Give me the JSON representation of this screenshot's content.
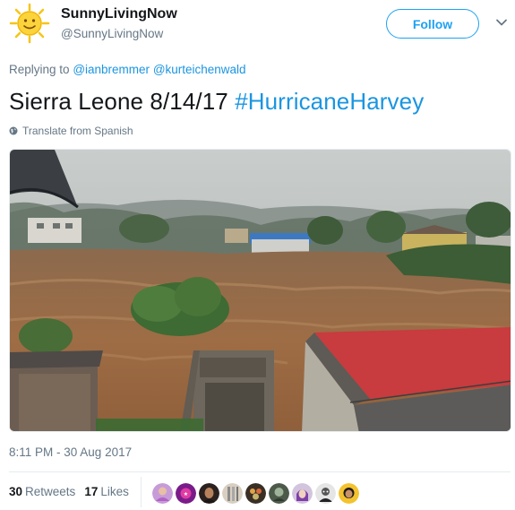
{
  "user": {
    "name": "SunnyLivingNow",
    "handle": "@SunnyLivingNow",
    "follow_label": "Follow"
  },
  "reply": {
    "prefix": "Replying to",
    "mentions": [
      "@ianbremmer",
      "@kurteichenwald"
    ]
  },
  "tweet": {
    "text": "Sierra Leone 8/14/17",
    "hashtag": "#HurricaneHarvey",
    "translate_label": "Translate from Spanish"
  },
  "timestamp": "8:11 PM - 30 Aug 2017",
  "stats": {
    "retweets_count": "30",
    "retweets_label": "Retweets",
    "likes_count": "17",
    "likes_label": "Likes"
  },
  "colors": {
    "accent": "#1da1f2",
    "link": "#1b95e0",
    "muted": "#657786",
    "text": "#14171a",
    "roof": "#c83b3e",
    "flood": "#9b6a44"
  },
  "likers": [
    "liker-avatar-1",
    "liker-avatar-2",
    "liker-avatar-3",
    "liker-avatar-4",
    "liker-avatar-5",
    "liker-avatar-6",
    "liker-avatar-7",
    "liker-avatar-8",
    "liker-avatar-9"
  ]
}
